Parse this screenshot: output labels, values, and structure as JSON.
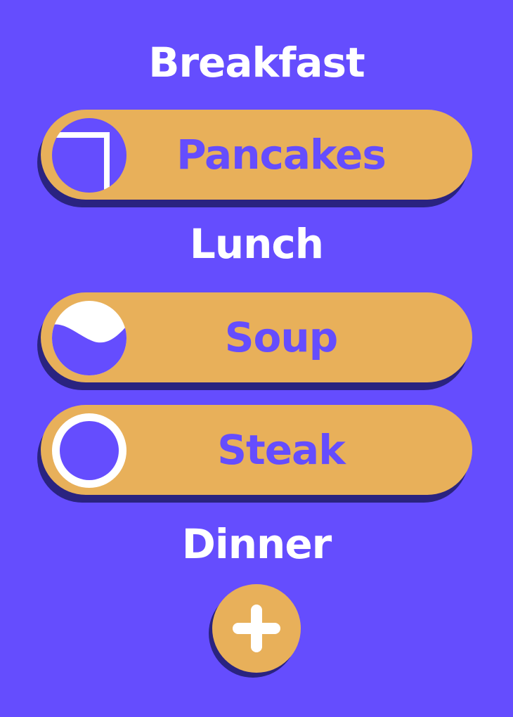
{
  "colors": {
    "background": "#654DFE",
    "pill": "#E8B05A",
    "shadow": "#2A2380",
    "heading_text": "#FFFFFF",
    "item_text": "#654DFE"
  },
  "sections": {
    "breakfast": "Breakfast",
    "lunch": "Lunch",
    "dinner": "Dinner"
  },
  "items": [
    {
      "label": "Pancakes",
      "status_icon": "progress-square-icon"
    },
    {
      "label": "Soup",
      "status_icon": "wave-filled-circle-icon"
    },
    {
      "label": "Steak",
      "status_icon": "empty-circle-icon"
    }
  ],
  "add_button": {
    "icon": "plus-icon"
  }
}
